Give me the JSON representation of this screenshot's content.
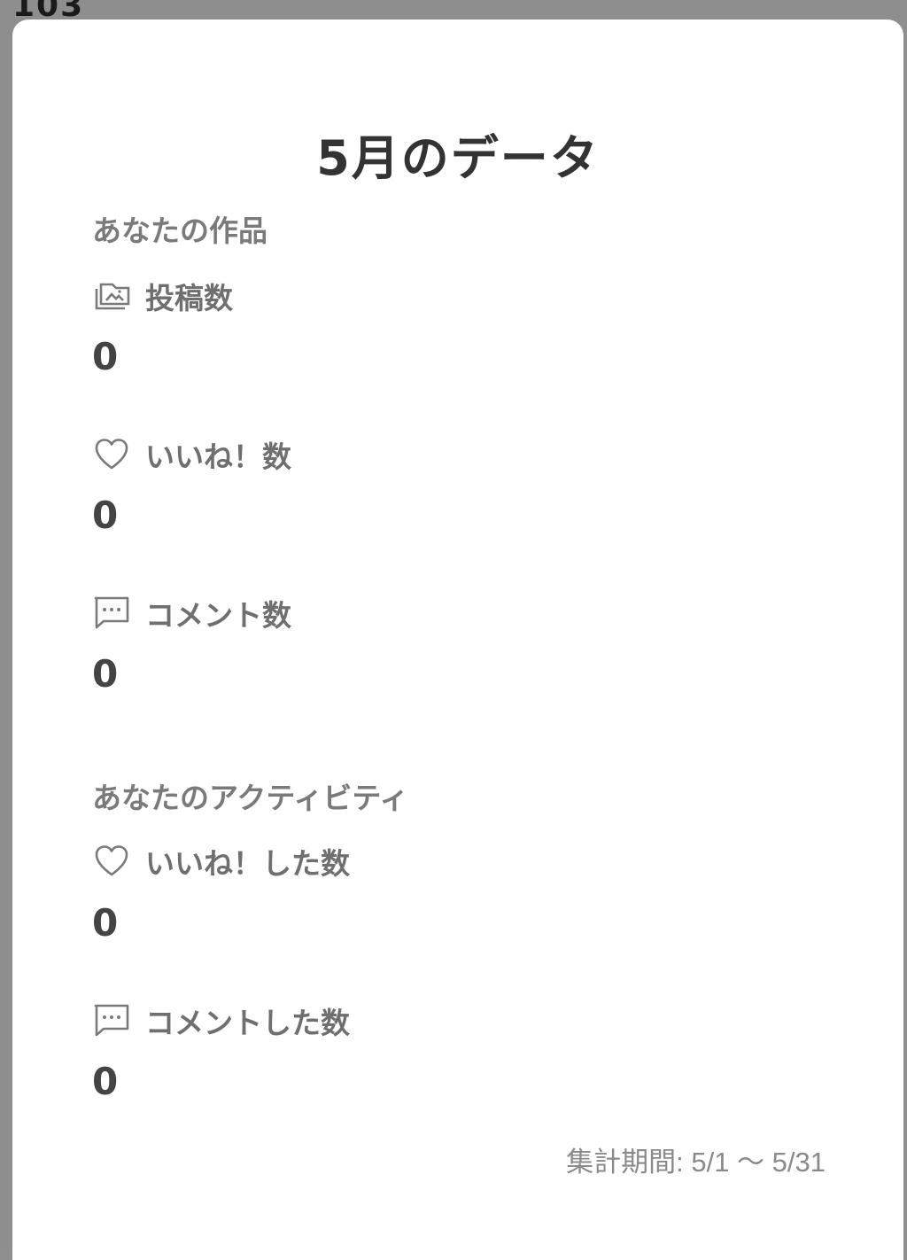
{
  "backdrop": {
    "partial_text": "103"
  },
  "modal": {
    "title": "5月のデータ",
    "works_section": {
      "heading": "あなたの作品",
      "metrics": [
        {
          "label": "投稿数",
          "value": "0",
          "icon": "gallery-icon"
        },
        {
          "label": "いいね！数",
          "value": "0",
          "icon": "heart-icon"
        },
        {
          "label": "コメント数",
          "value": "0",
          "icon": "comment-icon"
        }
      ]
    },
    "activity_section": {
      "heading": "あなたのアクティビティ",
      "metrics": [
        {
          "label": "いいね！した数",
          "value": "0",
          "icon": "heart-icon"
        },
        {
          "label": "コメントした数",
          "value": "0",
          "icon": "comment-icon"
        }
      ]
    },
    "period": "集計期間: 5/1 〜 5/31"
  },
  "colors": {
    "title": "#333333",
    "section_heading": "#7a7a7a",
    "label": "#6f6f6f",
    "value": "#444444",
    "backdrop": "#8e8e8e"
  }
}
